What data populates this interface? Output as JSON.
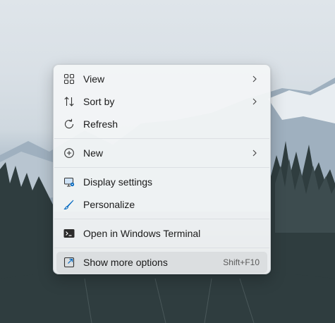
{
  "context_menu": {
    "items": [
      {
        "label": "View",
        "icon": "view-grid-icon",
        "has_submenu": true
      },
      {
        "label": "Sort by",
        "icon": "sort-icon",
        "has_submenu": true
      },
      {
        "label": "Refresh",
        "icon": "refresh-icon",
        "has_submenu": false
      },
      {
        "label": "New",
        "icon": "new-plus-icon",
        "has_submenu": true
      },
      {
        "label": "Display settings",
        "icon": "display-settings-icon",
        "has_submenu": false
      },
      {
        "label": "Personalize",
        "icon": "brush-icon",
        "has_submenu": false
      },
      {
        "label": "Open in Windows Terminal",
        "icon": "terminal-icon",
        "has_submenu": false
      },
      {
        "label": "Show more options",
        "icon": "show-more-icon",
        "shortcut": "Shift+F10",
        "has_submenu": false
      }
    ]
  },
  "colors": {
    "accent": "#0067c0",
    "menu_background": "#f3f5f7"
  }
}
